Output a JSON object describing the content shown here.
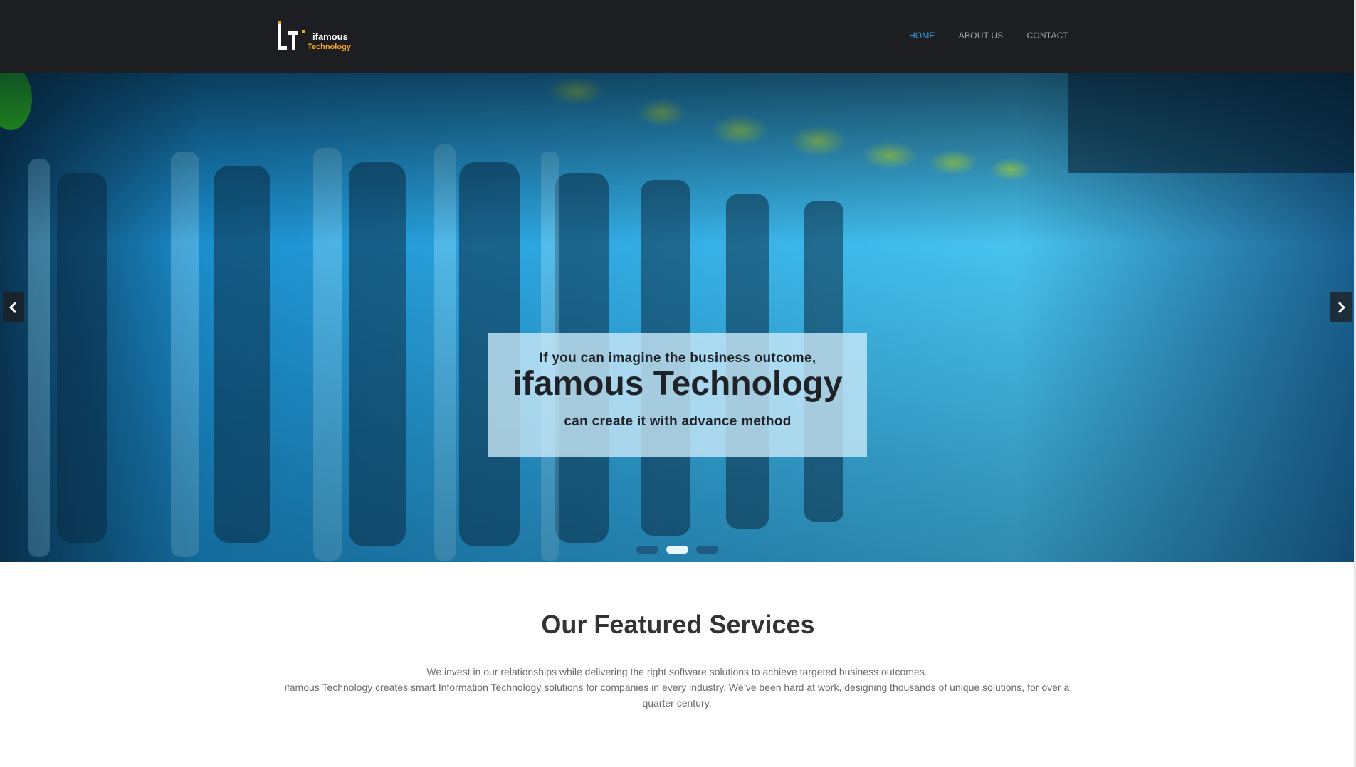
{
  "brand": {
    "name_line1": "ifamous",
    "name_line2": "Technology",
    "logo_mark": "iT-logo-mark",
    "colors": {
      "header_bg": "#1d1e22",
      "accent": "#3a9ad9",
      "logo_orange": "#f5a623"
    }
  },
  "nav": {
    "items": [
      {
        "label": "HOME",
        "active": true
      },
      {
        "label": "ABOUT US",
        "active": false
      },
      {
        "label": "CONTACT",
        "active": false
      }
    ]
  },
  "hero": {
    "caption_pre": "If you can imagine the business outcome,",
    "caption_title": "ifamous Technology",
    "caption_post": "can create it with advance method",
    "prev_icon": "chevron-left-icon",
    "next_icon": "chevron-right-icon",
    "slide_count": 3,
    "active_slide": 2
  },
  "services": {
    "title": "Our Featured Services",
    "desc_line1": "We invest in our relationships while delivering the right software solutions to achieve targeted business outcomes.",
    "desc_line2": "ifamous Technology creates smart Information Technology solutions for companies in every industry. We’ve been hard at work, designing thousands of unique solutions, for over a quarter century."
  }
}
